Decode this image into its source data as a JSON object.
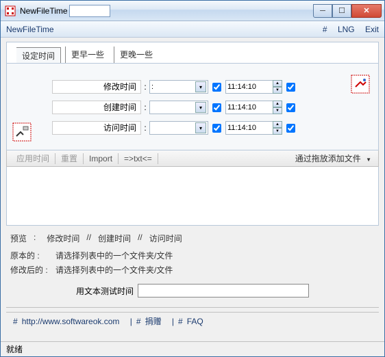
{
  "window": {
    "title": "NewFileTime"
  },
  "menu": {
    "app": "NewFileTime",
    "hash": "#",
    "lng": "LNG",
    "exit": "Exit"
  },
  "tabs": [
    "设定时间",
    "更早一些",
    "更晚一些"
  ],
  "rows": {
    "modify": {
      "label": "修改时间",
      "date": ":",
      "time": "11:14:10"
    },
    "create": {
      "label": "创建时间",
      "date": "",
      "time": "11:14:10"
    },
    "access": {
      "label": "访问时间",
      "date": "",
      "time": "11:14:10"
    }
  },
  "toolbar": {
    "apply": "应用时间",
    "reset": "重置",
    "import": "Import",
    "txt": "=>txt<=",
    "drop": "通过拖放添加文件"
  },
  "preview": {
    "label": "预览",
    "modify": "修改时间",
    "create": "创建时间",
    "access": "访问时间",
    "sep": "//"
  },
  "original": {
    "label": "原本的",
    "text": "请选择列表中的一个文件夹/文件"
  },
  "after": {
    "label": "修改后的",
    "text": "请选择列表中的一个文件夹/文件"
  },
  "test": {
    "label": "用文本测试时间",
    "value": ""
  },
  "footer": {
    "url": "http://www.softwareok.com",
    "donate": "捐赠",
    "faq": "FAQ",
    "hash": "#",
    "sep": "|"
  },
  "status": {
    "text": "就绪"
  }
}
